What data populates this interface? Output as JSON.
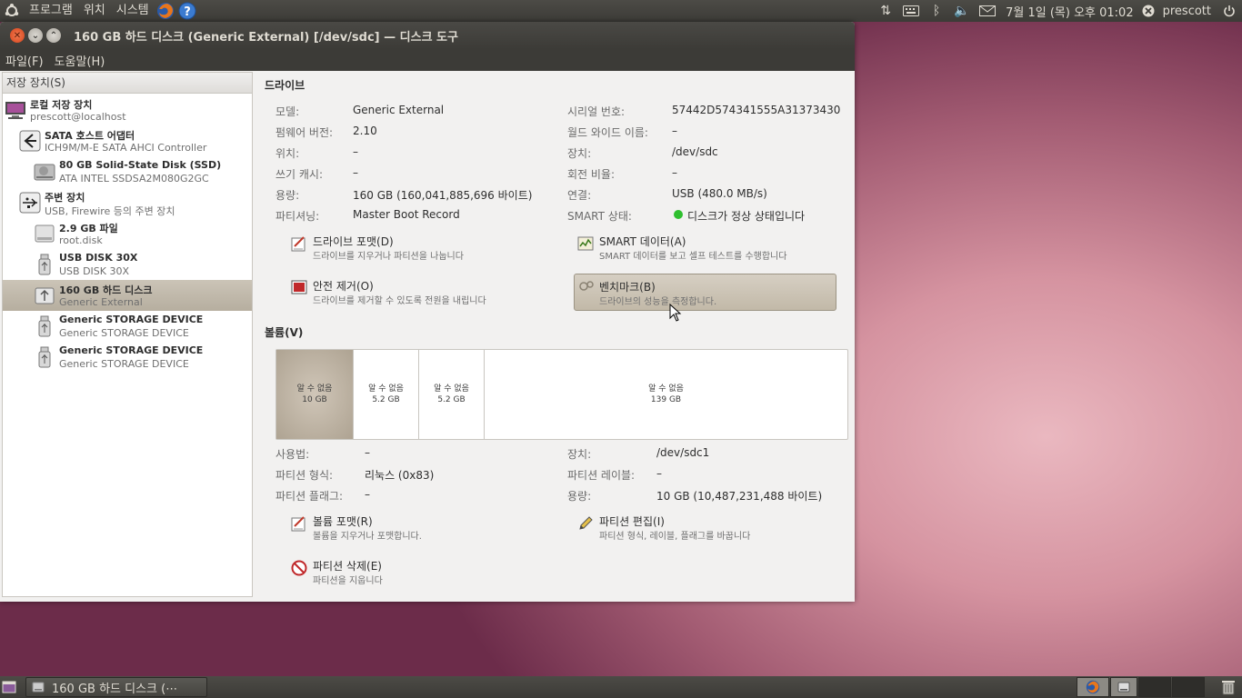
{
  "top_panel": {
    "menus": [
      "프로그램",
      "위치",
      "시스템"
    ],
    "clock": "7월  1일 (목) 오후 01:02",
    "user": "prescott"
  },
  "window": {
    "title": "160 GB 하드 디스크 (Generic External) [/dev/sdc] — 디스크 도구",
    "menus": [
      "파일(F)",
      "도움말(H)"
    ]
  },
  "sidebar": {
    "header": "저장 장치(S)",
    "items": [
      {
        "name": "로컬 저장 장치",
        "sub": "prescott@localhost",
        "icon": "computer-icon"
      },
      {
        "name": "SATA 호스트 어댑터",
        "sub": "ICH9M/M-E SATA AHCI Controller",
        "icon": "sata-adapter-icon"
      },
      {
        "name": "80 GB Solid-State Disk (SSD)",
        "sub": "ATA INTEL SSDSA2M080G2GC",
        "icon": "harddisk-icon"
      },
      {
        "name": "주변 장치",
        "sub": "USB, Firewire 등의 주변 장치",
        "icon": "usb-icon"
      },
      {
        "name": "2.9 GB 파일",
        "sub": "root.disk",
        "icon": "file-disk-icon"
      },
      {
        "name": "USB DISK 30X",
        "sub": "USB DISK 30X",
        "icon": "usb-stick-icon"
      },
      {
        "name": "160 GB 하드 디스크",
        "sub": "Generic External",
        "icon": "usb-drive-icon"
      },
      {
        "name": "Generic STORAGE DEVICE",
        "sub": "Generic STORAGE DEVICE",
        "icon": "usb-stick-icon"
      },
      {
        "name": "Generic STORAGE DEVICE",
        "sub": "Generic STORAGE DEVICE",
        "icon": "usb-stick-icon"
      }
    ]
  },
  "drive": {
    "title": "드라이브",
    "left": [
      {
        "label": "모델:",
        "value": "Generic External"
      },
      {
        "label": "펌웨어 버전:",
        "value": "2.10"
      },
      {
        "label": "위치:",
        "value": "–"
      },
      {
        "label": "쓰기 캐시:",
        "value": "–"
      },
      {
        "label": "용량:",
        "value": "160 GB (160,041,885,696 바이트)"
      },
      {
        "label": "파티셔닝:",
        "value": "Master Boot Record"
      }
    ],
    "right": [
      {
        "label": "시리얼 번호:",
        "value": "57442D574341555A31373430"
      },
      {
        "label": "월드 와이드 이름:",
        "value": "–"
      },
      {
        "label": "장치:",
        "value": "/dev/sdc"
      },
      {
        "label": "회전 비율:",
        "value": "–"
      },
      {
        "label": "연결:",
        "value": "USB (480.0 MB/s)"
      },
      {
        "label": "SMART 상태:",
        "value": "디스크가 정상 상태입니다"
      }
    ],
    "actions": [
      {
        "title": "드라이브 포맷(D)",
        "sub": "드라이브를 지우거나 파티션을 나눕니다"
      },
      {
        "title": "SMART 데이터(A)",
        "sub": "SMART 데이터를 보고 셀프 테스트를 수행합니다"
      },
      {
        "title": "안전 제거(O)",
        "sub": "드라이브를 제거할 수 있도록 전원을 내립니다"
      },
      {
        "title": "벤치마크(B)",
        "sub": "드라이브의 성능을 측정합니다."
      }
    ],
    "status_color": "#2fbf2f"
  },
  "volumes": {
    "title": "볼륨(V)",
    "segments": [
      {
        "label": "알 수 없음",
        "size": "10 GB",
        "selected": true
      },
      {
        "label": "알 수 없음",
        "size": "5.2 GB"
      },
      {
        "label": "알 수 없음",
        "size": "5.2 GB"
      },
      {
        "label": "알 수 없음",
        "size": "139 GB"
      }
    ],
    "left": [
      {
        "label": "사용법:",
        "value": "–"
      },
      {
        "label": "파티션 형식:",
        "value": "리눅스 (0x83)"
      },
      {
        "label": "파티션 플래그:",
        "value": "–"
      }
    ],
    "right": [
      {
        "label": "장치:",
        "value": "/dev/sdc1"
      },
      {
        "label": "파티션 레이블:",
        "value": "–"
      },
      {
        "label": "용량:",
        "value": "10 GB (10,487,231,488 바이트)"
      }
    ],
    "actions": [
      {
        "title": "볼륨 포맷(R)",
        "sub": "볼륨을 지우거나 포맷합니다."
      },
      {
        "title": "파티션 편집(I)",
        "sub": "파티션 형식, 레이블, 플래그를 바꿉니다"
      },
      {
        "title": "파티션 삭제(E)",
        "sub": "파티션을 지웁니다"
      }
    ]
  },
  "taskbar": {
    "task_label": "160 GB 하드 디스크 (⋯"
  }
}
